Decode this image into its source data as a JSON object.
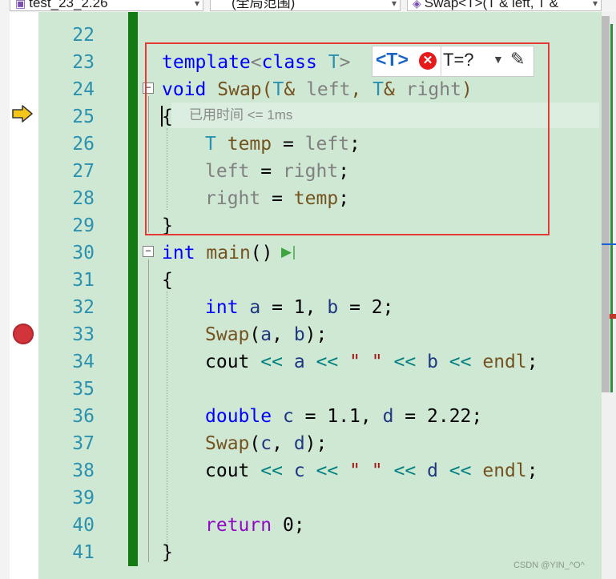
{
  "navbar": {
    "project_dropdown": "test_23_2.26",
    "scope_dropdown": "(全局范围)",
    "member_dropdown": "Swap<T>(T & left, T &"
  },
  "template_bar": {
    "param_badge": "<T>",
    "param_value": "T=?"
  },
  "perf_tip": "已用时间 <= 1ms",
  "watermark": "CSDN @YIN_^O^",
  "lines": [
    {
      "num": "22"
    },
    {
      "num": "23"
    },
    {
      "num": "24"
    },
    {
      "num": "25"
    },
    {
      "num": "26"
    },
    {
      "num": "27"
    },
    {
      "num": "28"
    },
    {
      "num": "29"
    },
    {
      "num": "30"
    },
    {
      "num": "31"
    },
    {
      "num": "32"
    },
    {
      "num": "33"
    },
    {
      "num": "34"
    },
    {
      "num": "35"
    },
    {
      "num": "36"
    },
    {
      "num": "37"
    },
    {
      "num": "38"
    },
    {
      "num": "39"
    },
    {
      "num": "40"
    },
    {
      "num": "41"
    }
  ],
  "code": {
    "l23": {
      "t1": "template",
      "t2": "<",
      "t3": "class",
      "t4": " ",
      "t5": "T",
      "t6": ">"
    },
    "l24": {
      "t1": "void",
      "t2": " ",
      "t3": "Swap",
      "t4": "(",
      "t5": "T",
      "t6": "& ",
      "t7": "left",
      "t8": ", ",
      "t9": "T",
      "t10": "& ",
      "t11": "right",
      "t12": ")"
    },
    "l25": {
      "t1": "{"
    },
    "l26": {
      "t1": "T",
      "t2": " ",
      "t3": "temp",
      "t4": " = ",
      "t5": "left",
      "t6": ";"
    },
    "l27": {
      "t1": "left",
      "t2": " = ",
      "t3": "right",
      "t4": ";"
    },
    "l28": {
      "t1": "right",
      "t2": " = ",
      "t3": "temp",
      "t4": ";"
    },
    "l29": {
      "t1": "}"
    },
    "l30": {
      "t1": "int",
      "t2": " ",
      "t3": "main",
      "t4": "()"
    },
    "l31": {
      "t1": "{"
    },
    "l32": {
      "t1": "int",
      "t2": " ",
      "t3": "a",
      "t4": " = 1, ",
      "t5": "b",
      "t6": " = 2;"
    },
    "l33": {
      "t1": "Swap",
      "t2": "(",
      "t3": "a",
      "t4": ", ",
      "t5": "b",
      "t6": ");"
    },
    "l34": {
      "t1": "cout",
      "t2": " ",
      "t3": "<<",
      "t4": " ",
      "t5": "a",
      "t6": " ",
      "t7": "<<",
      "t8": " ",
      "t9": "\" \"",
      "t10": " ",
      "t11": "<<",
      "t12": " ",
      "t13": "b",
      "t14": " ",
      "t15": "<<",
      "t16": " ",
      "t17": "endl",
      "t18": ";"
    },
    "l36": {
      "t1": "double",
      "t2": " ",
      "t3": "c",
      "t4": " = 1.1, ",
      "t5": "d",
      "t6": " = 2.22;"
    },
    "l37": {
      "t1": "Swap",
      "t2": "(",
      "t3": "c",
      "t4": ", ",
      "t5": "d",
      "t6": ");"
    },
    "l38": {
      "t1": "cout",
      "t2": " ",
      "t3": "<<",
      "t4": " ",
      "t5": "c",
      "t6": " ",
      "t7": "<<",
      "t8": " ",
      "t9": "\" \"",
      "t10": " ",
      "t11": "<<",
      "t12": " ",
      "t13": "d",
      "t14": " ",
      "t15": "<<",
      "t16": " ",
      "t17": "endl",
      "t18": ";"
    },
    "l40": {
      "t1": "return",
      "t2": " 0;"
    },
    "l41": {
      "t1": "}"
    }
  },
  "colors": {
    "editor_background": "#cfe8d4",
    "line_number": "#2b91af",
    "keyword": "#0000ff",
    "changed_margin": "#147a14",
    "highlight_box": "#e53935"
  }
}
